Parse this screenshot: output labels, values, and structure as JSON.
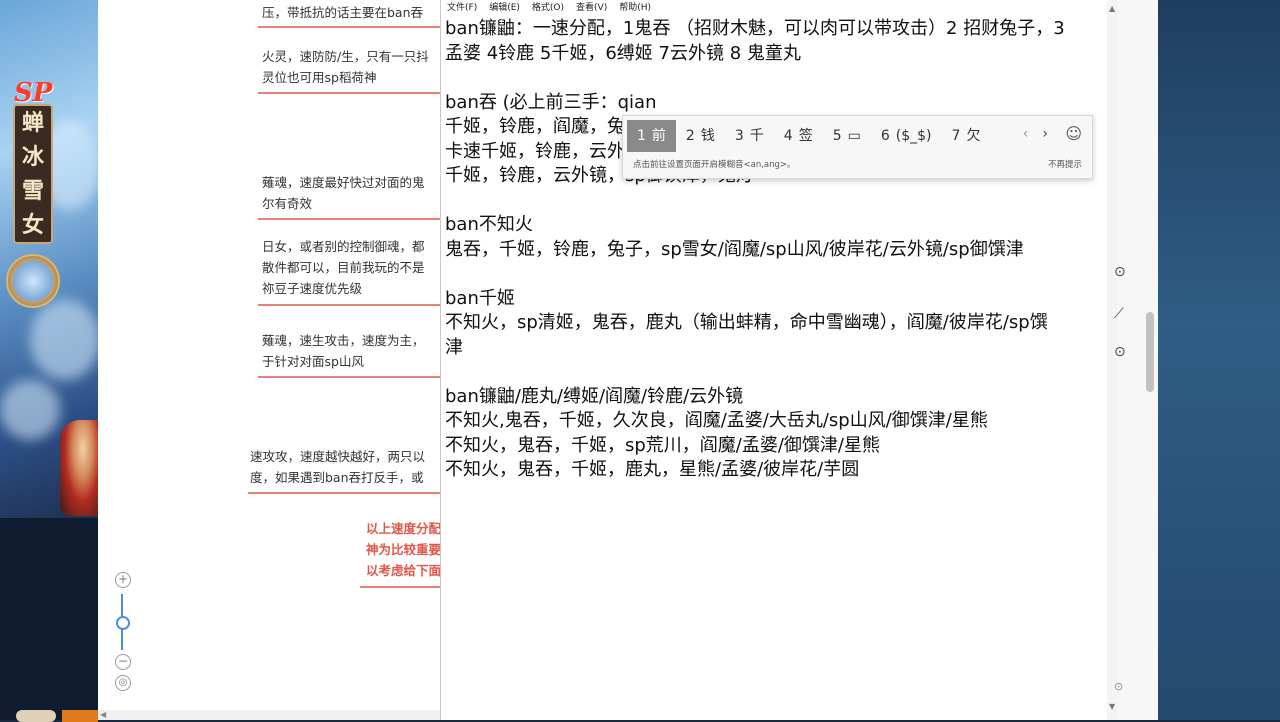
{
  "left_game": {
    "sp_badge": "SP",
    "name_chars": [
      "蝉",
      "冰",
      "雪",
      "女"
    ]
  },
  "document": {
    "paragraphs": [
      [
        "压，带抵抗的话主要在ban吞"
      ],
      [
        "火灵，速防防/生，只有一只抖",
        "灵位也可用sp稻荷神"
      ],
      [
        "薙魂，速度最好快过对面的鬼",
        "尔有奇效"
      ],
      [
        "日女，或者别的控制御魂，都",
        "散件都可以，目前我玩的不是",
        "祢豆子速度优先级"
      ],
      [
        "薙魂，速生攻击，速度为主，",
        "于针对对面sp山风"
      ],
      [
        "速攻攻，速度越快越好，两只以",
        "度，如果遇到ban吞打反手，或"
      ]
    ],
    "red_note": [
      "以上速度分配",
      "神为比较重要",
      "以考虑给下面"
    ],
    "zoom_in": "+",
    "zoom_out": "−"
  },
  "notepad": {
    "menu": [
      "文件(F)",
      "编辑(E)",
      "格式(O)",
      "查看(V)",
      "帮助(H)"
    ],
    "lines": [
      "ban镰鼬：一速分配，1鬼吞 （招财木魅，可以肉可以带攻击）2 招财兔子，3",
      "孟婆 4铃鹿 5千姬，6缚姬 7云外镜 8 鬼童丸",
      "",
      "ban吞 (必上前三手：qian",
      "千姬，铃鹿，阎魔，兔",
      "卡速千姬，铃鹿，云外",
      "千姬，铃鹿，云外镜，sp御馔津，鬼灯",
      "",
      "ban不知火",
      "鬼吞，千姬，铃鹿，兔子，sp雪女/阎魔/sp山风/彼岸花/云外镜/sp御馔津",
      "",
      "ban千姬",
      "不知火，sp清姬，鬼吞，鹿丸（输出蚌精，命中雪幽魂），阎魔/彼岸花/sp馔",
      "津",
      "",
      "ban镰鼬/鹿丸/缚姬/阎魔/铃鹿/云外镜",
      "不知火,鬼吞，千姬，久次良，阎魔/孟婆/大岳丸/sp山风/御馔津/星熊",
      "不知火，鬼吞，千姬，sp荒川，阎魔/孟婆/御馔津/星熊",
      "不知火，鬼吞，千姬，鹿丸，星熊/孟婆/彼岸花/芋圆"
    ]
  },
  "ime": {
    "candidates": [
      {
        "num": "1",
        "text": "前"
      },
      {
        "num": "2",
        "text": "钱"
      },
      {
        "num": "3",
        "text": "千"
      },
      {
        "num": "4",
        "text": "签"
      },
      {
        "num": "5",
        "text": "▭"
      },
      {
        "num": "6",
        "text": "($_$)"
      },
      {
        "num": "7",
        "text": "欠"
      }
    ],
    "prev": "‹",
    "next": "›",
    "emoji": "☺",
    "hint": "点击前往设置页面开启模糊音<an,ang>。",
    "dismiss": "不再提示"
  }
}
